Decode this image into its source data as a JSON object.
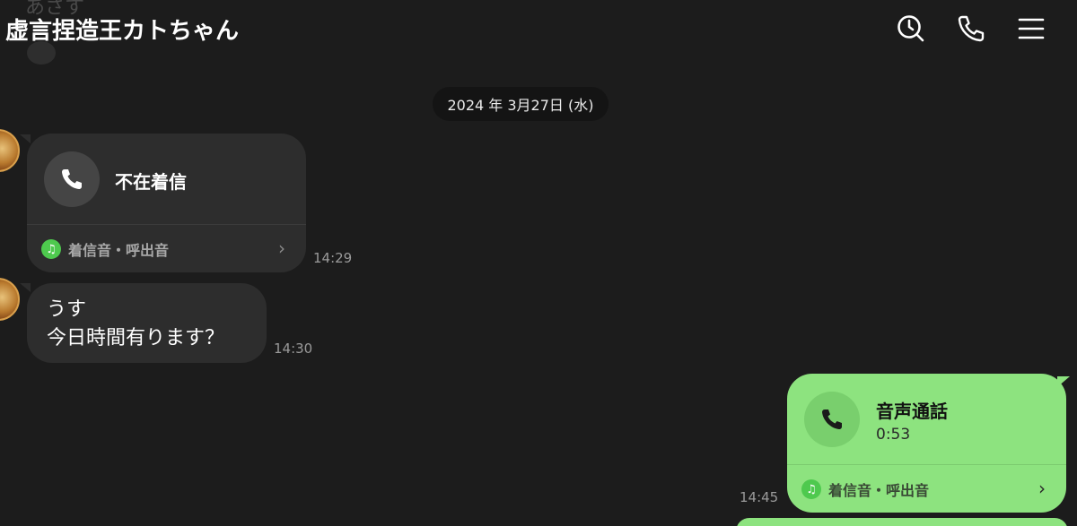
{
  "header": {
    "title": "虚言捏造王カトちゃん",
    "faded_previous_text": "あさす",
    "icons": [
      "search-icon",
      "phone-icon",
      "menu-icon"
    ]
  },
  "date_separator": "2024 年 3月27日 (水)",
  "messages": [
    {
      "type": "call",
      "direction": "incoming",
      "title": "不在着信",
      "ringtone_label": "着信音・呼出音",
      "time": "14:29"
    },
    {
      "type": "text",
      "direction": "incoming",
      "text": "うす\n今日時間有ります？",
      "time": "14:30"
    },
    {
      "type": "call",
      "direction": "outgoing",
      "title": "音声通話",
      "duration": "0:53",
      "ringtone_label": "着信音・呼出音",
      "time": "14:45"
    }
  ],
  "colors": {
    "background": "#1c1c1c",
    "incoming_bubble": "#2d2d2d",
    "outgoing_bubble": "#8de37f",
    "music_badge": "#4ec94e"
  }
}
